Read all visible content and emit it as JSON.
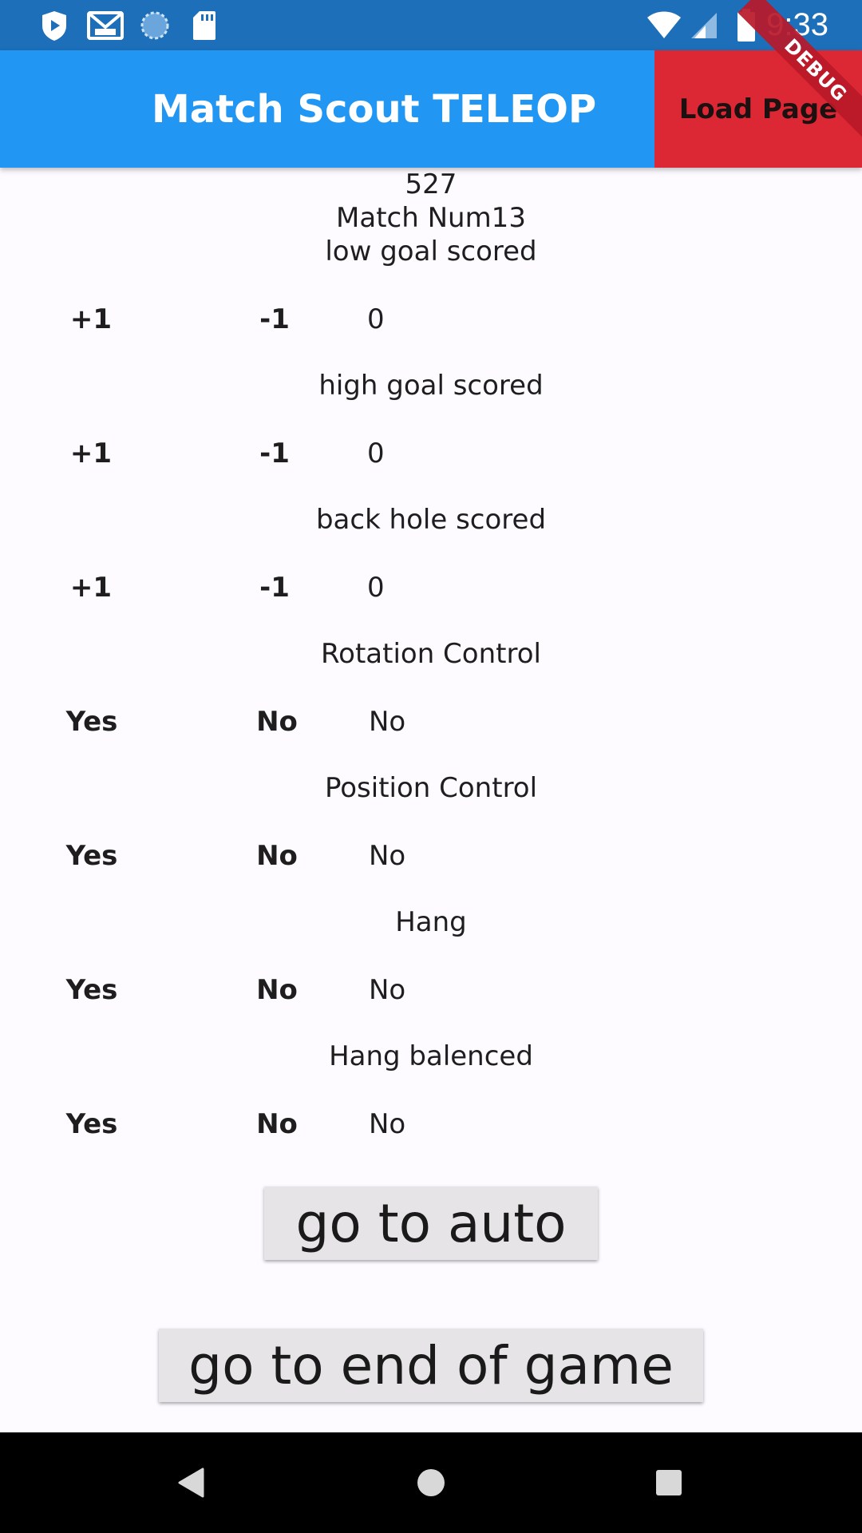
{
  "status_bar": {
    "time": "9:33",
    "icons": [
      "shield-icon",
      "gmail-icon",
      "sync-icon",
      "sd-card-icon",
      "wifi-icon",
      "signal-icon",
      "battery-icon"
    ]
  },
  "app_bar": {
    "title": "Match Scout TELEOP ...",
    "load_page_label": "Load Page",
    "debug_label": "DEBUG",
    "colors": {
      "bar": "#2196f3",
      "load_button": "#dc2835"
    }
  },
  "header": {
    "team": "527",
    "match": "Match Num13"
  },
  "counters": [
    {
      "label": "low goal scored",
      "plus": "+1",
      "minus": "-1",
      "value": "0"
    },
    {
      "label": "high goal scored",
      "plus": "+1",
      "minus": "-1",
      "value": "0"
    },
    {
      "label": "back hole scored",
      "plus": "+1",
      "minus": "-1",
      "value": "0"
    }
  ],
  "toggles": [
    {
      "label": "Rotation Control",
      "yes": "Yes",
      "no": "No",
      "value": "No"
    },
    {
      "label": "Position Control",
      "yes": "Yes",
      "no": "No",
      "value": "No"
    },
    {
      "label": "Hang",
      "yes": "Yes",
      "no": "No",
      "value": "No"
    },
    {
      "label": "Hang balenced",
      "yes": "Yes",
      "no": "No",
      "value": "No"
    }
  ],
  "buttons": {
    "go_auto": "go to auto",
    "go_end": "go to end of game"
  },
  "nav": [
    "back-icon",
    "home-icon",
    "recents-icon"
  ]
}
